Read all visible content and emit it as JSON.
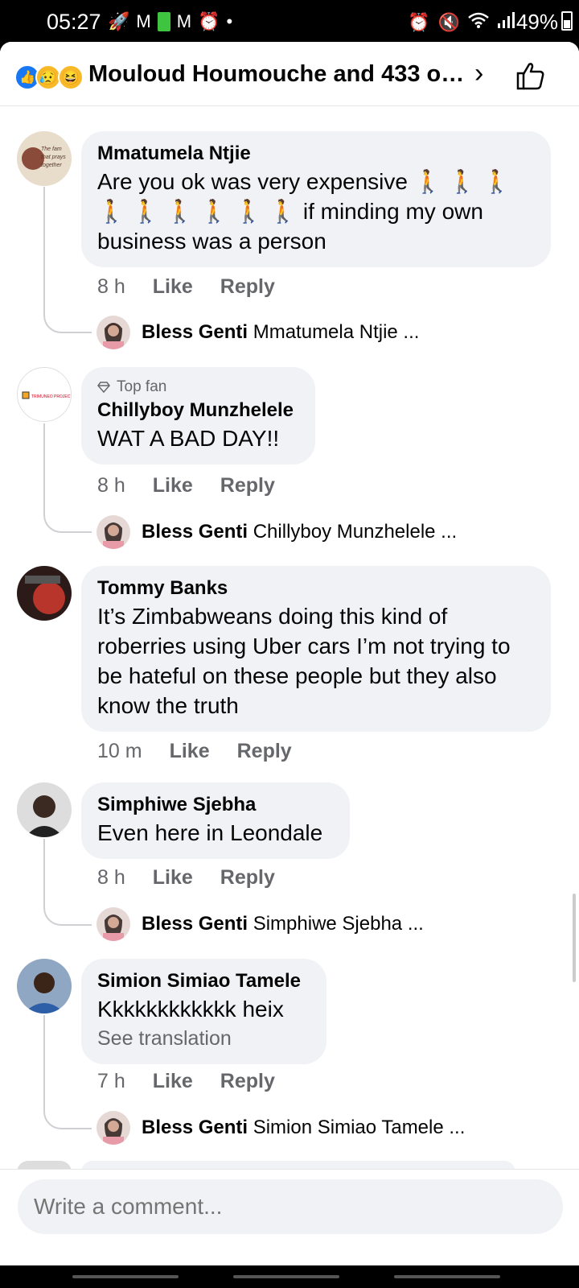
{
  "status_bar": {
    "time": "05:27",
    "battery": "49%",
    "left_icons": [
      "rocket-icon",
      "gmail-icon",
      "battery-app-icon",
      "gmail-icon",
      "alarm-face-icon",
      "dot-icon"
    ],
    "right_icons": [
      "alarm-icon",
      "mute-icon",
      "wifi-icon",
      "signal-icon"
    ]
  },
  "header": {
    "title": "Mouloud Houmouche and 433 ot...",
    "reactions": [
      "like",
      "sad",
      "haha"
    ]
  },
  "comments": [
    {
      "author": "Mmatumela Ntjie",
      "text": "Are you ok was very expensive 🚶 🚶 🚶 🚶 🚶 🚶 🚶 🚶 🚶 if minding my own business was a person",
      "time": "8 h",
      "like": "Like",
      "reply": "Reply",
      "reply_preview": {
        "author": "Bless Genti",
        "snippet": "Mmatumela Ntjie ..."
      }
    },
    {
      "badge": "Top fan",
      "author": "Chillyboy Munzhelele",
      "text": "WAT A BAD DAY!!",
      "time": "8 h",
      "like": "Like",
      "reply": "Reply",
      "reply_preview": {
        "author": "Bless Genti",
        "snippet": "Chillyboy Munzhelele ..."
      }
    },
    {
      "author": "Tommy Banks",
      "text": "It’s Zimbabweans doing this kind of roberries using Uber cars I’m not trying to be hateful on these people but they also know the truth",
      "time": "10 m",
      "like": "Like",
      "reply": "Reply"
    },
    {
      "author": "Simphiwe Sjebha",
      "text": "Even here in Leondale",
      "time": "8 h",
      "like": "Like",
      "reply": "Reply",
      "reply_preview": {
        "author": "Bless Genti",
        "snippet": "Simphiwe Sjebha ..."
      }
    },
    {
      "author": "Simion Simiao Tamele",
      "text": "Kkkkkkkkkkkk heix",
      "see_translation": "See translation",
      "time": "7 h",
      "like": "Like",
      "reply": "Reply",
      "reply_preview": {
        "author": "Bless Genti",
        "snippet": "Simion Simiao Tamele ..."
      }
    }
  ],
  "composer": {
    "placeholder": "Write a comment..."
  }
}
